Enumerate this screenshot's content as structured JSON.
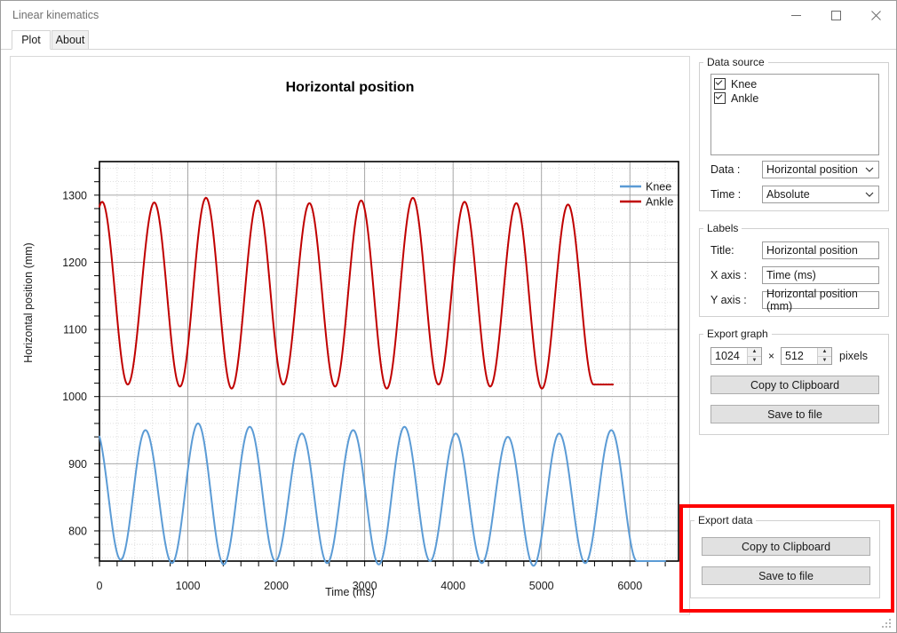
{
  "window": {
    "title": "Linear kinematics",
    "minimize_icon": "minimize-icon",
    "maximize_icon": "maximize-icon",
    "close_icon": "close-icon"
  },
  "tabs": [
    {
      "label": "Plot",
      "active": true
    },
    {
      "label": "About",
      "active": false
    }
  ],
  "data_source": {
    "legend": "Data source",
    "items": [
      {
        "label": "Knee",
        "checked": true
      },
      {
        "label": "Ankle",
        "checked": true
      }
    ],
    "data_label": "Data :",
    "data_value": "Horizontal position",
    "time_label": "Time :",
    "time_value": "Absolute"
  },
  "labels_group": {
    "legend": "Labels",
    "title_label": "Title:",
    "title_value": "Horizontal position",
    "xaxis_label": "X axis :",
    "xaxis_value": "Time (ms)",
    "yaxis_label": "Y axis :",
    "yaxis_value": "Horizontal position (mm)"
  },
  "export_graph": {
    "legend": "Export graph",
    "width_value": "1024",
    "height_value": "512",
    "times_symbol": "×",
    "units": "pixels",
    "copy_label": "Copy to Clipboard",
    "save_label": "Save to file"
  },
  "export_data": {
    "legend": "Export data",
    "copy_label": "Copy to Clipboard",
    "save_label": "Save to file",
    "highlight_color": "#fe0000"
  },
  "chart_data": {
    "type": "line",
    "title": "Horizontal position",
    "xlabel": "Time (ms)",
    "ylabel": "Horizontal position (mm)",
    "xlim": [
      0,
      6550
    ],
    "ylim": [
      755,
      1350
    ],
    "xticks": [
      0,
      1000,
      2000,
      3000,
      4000,
      5000,
      6000
    ],
    "yticks": [
      800,
      900,
      1000,
      1100,
      1200,
      1300
    ],
    "x_minor_step": 200,
    "y_minor_step": 20,
    "grid": true,
    "legend_position": "top-right",
    "series": [
      {
        "name": "Knee",
        "color": "#5b9bd5",
        "x_start": 0,
        "x_end": 6400,
        "period": 580,
        "phase_offset": 215,
        "peak": 955,
        "trough": 752,
        "peaks": [
          {
            "x": 520,
            "y": 950
          },
          {
            "x": 1115,
            "y": 960
          },
          {
            "x": 1700,
            "y": 955
          },
          {
            "x": 2290,
            "y": 945
          },
          {
            "x": 2870,
            "y": 950
          },
          {
            "x": 3450,
            "y": 955
          },
          {
            "x": 4030,
            "y": 945
          },
          {
            "x": 4620,
            "y": 940
          },
          {
            "x": 5200,
            "y": 945
          },
          {
            "x": 5790,
            "y": 950
          }
        ],
        "troughs": [
          {
            "x": 240,
            "y": 757
          },
          {
            "x": 820,
            "y": 752
          },
          {
            "x": 1405,
            "y": 750
          },
          {
            "x": 1990,
            "y": 755
          },
          {
            "x": 2575,
            "y": 752
          },
          {
            "x": 3160,
            "y": 750
          },
          {
            "x": 3740,
            "y": 755
          },
          {
            "x": 4325,
            "y": 752
          },
          {
            "x": 4910,
            "y": 748
          },
          {
            "x": 5495,
            "y": 752
          },
          {
            "x": 6080,
            "y": 755
          }
        ]
      },
      {
        "name": "Ankle",
        "color": "#c00000",
        "x_start": 0,
        "x_end": 5810,
        "period": 580,
        "phase_offset": 20,
        "peak": 1296,
        "trough": 1012,
        "peaks": [
          {
            "x": 30,
            "y": 1290
          },
          {
            "x": 620,
            "y": 1289
          },
          {
            "x": 1205,
            "y": 1296
          },
          {
            "x": 1790,
            "y": 1292
          },
          {
            "x": 2375,
            "y": 1288
          },
          {
            "x": 2960,
            "y": 1292
          },
          {
            "x": 3545,
            "y": 1296
          },
          {
            "x": 4130,
            "y": 1290
          },
          {
            "x": 4715,
            "y": 1288
          },
          {
            "x": 5300,
            "y": 1286
          }
        ],
        "troughs": [
          {
            "x": 320,
            "y": 1018
          },
          {
            "x": 910,
            "y": 1015
          },
          {
            "x": 1495,
            "y": 1012
          },
          {
            "x": 2080,
            "y": 1018
          },
          {
            "x": 2665,
            "y": 1015
          },
          {
            "x": 3250,
            "y": 1012
          },
          {
            "x": 3835,
            "y": 1018
          },
          {
            "x": 4420,
            "y": 1015
          },
          {
            "x": 5005,
            "y": 1012
          },
          {
            "x": 5590,
            "y": 1018
          }
        ]
      }
    ]
  }
}
